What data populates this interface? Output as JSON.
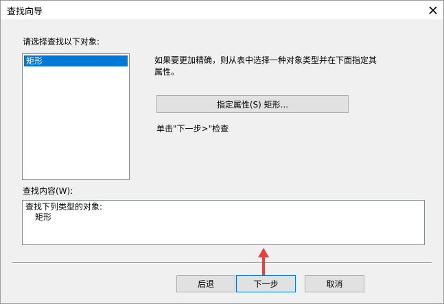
{
  "window": {
    "title": "查找向导",
    "close_icon": "close-icon"
  },
  "select_label": "请选择查找以下对象:",
  "object_list": [
    "矩形"
  ],
  "hint": "如果要更加精确，则从表中选择一种对象类型并在下面指定其属性。",
  "specify_button": "指定属性(S) 矩形...",
  "step_text": "单击\"下一步>\"检查",
  "content_label": "查找内容(W):",
  "content": {
    "line1": "查找下列类型的对象:",
    "line2": "矩形"
  },
  "buttons": {
    "back": "后退",
    "next": "下一步",
    "cancel": "取消"
  },
  "annotation_color": "#e8403a"
}
